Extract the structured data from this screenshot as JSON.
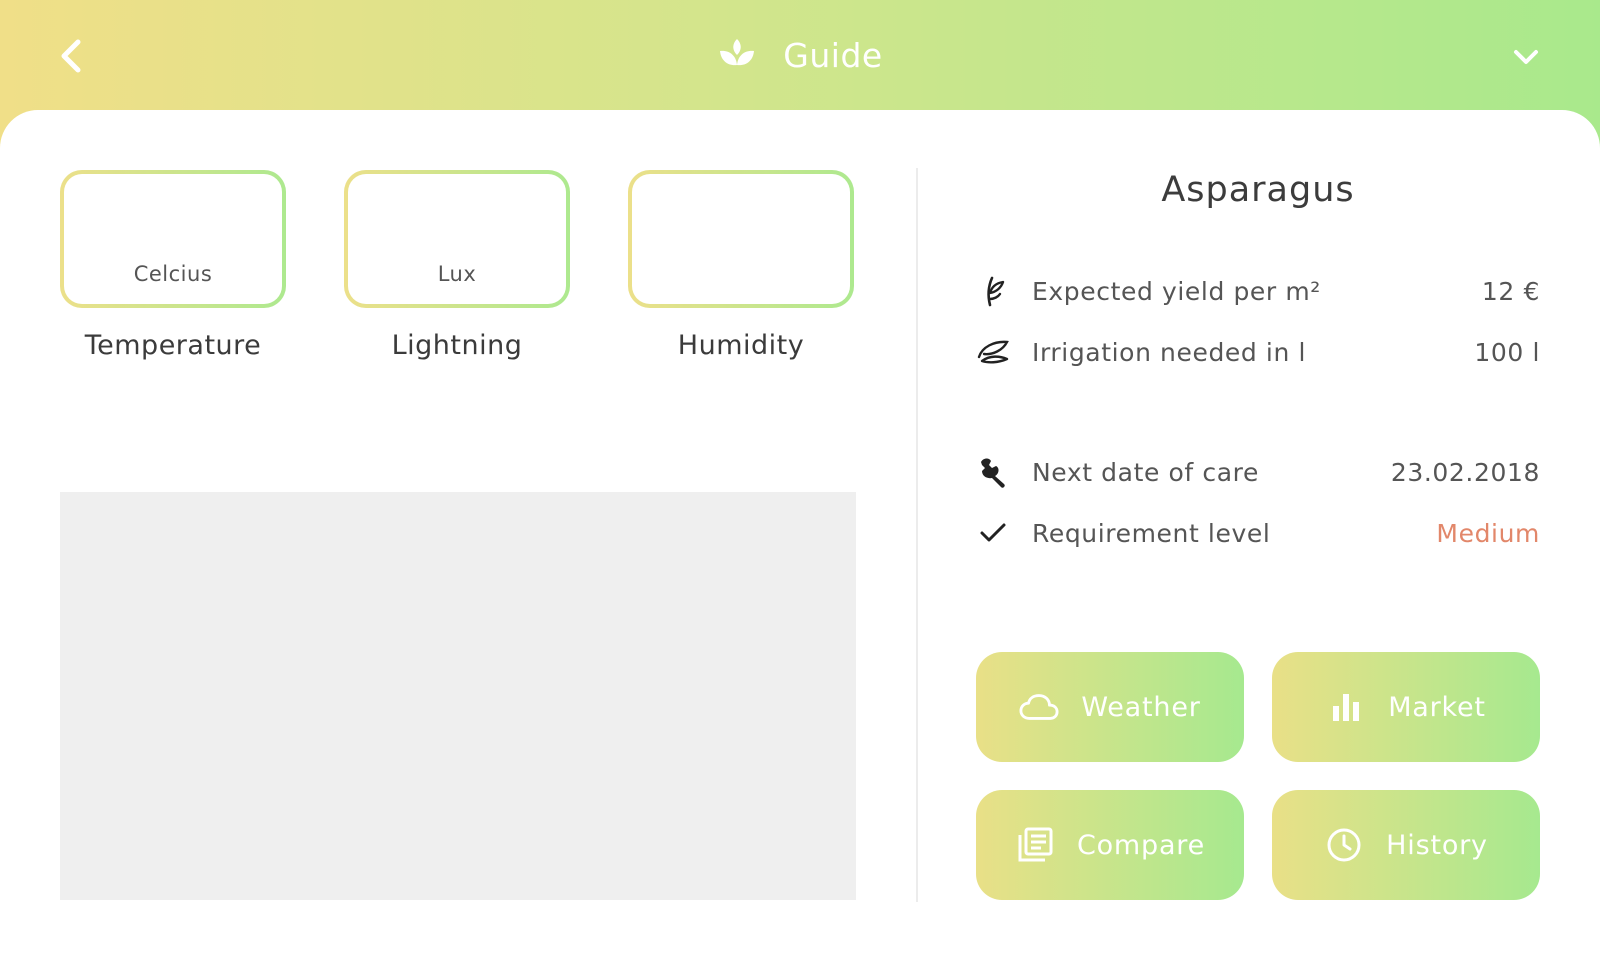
{
  "header": {
    "title": "Guide",
    "back_icon": "chevron-left-icon",
    "logo_icon": "plant-leaves-icon",
    "menu_icon": "chevron-down-icon"
  },
  "metrics": [
    {
      "unit": "Celcius",
      "label": "Temperature"
    },
    {
      "unit": "Lux",
      "label": "Lightning"
    },
    {
      "unit": "",
      "label": "Humidity"
    }
  ],
  "plant": {
    "name": "Asparagus",
    "info": [
      {
        "icon": "sprout-icon",
        "label": "Expected yield per m²",
        "value": "12 €"
      },
      {
        "icon": "water-drops-icon",
        "label": "Irrigation needed in l",
        "value": "100 l"
      },
      {
        "icon": "wrench-icon",
        "label": "Next date of care",
        "value": "23.02.2018"
      },
      {
        "icon": "checkmark-icon",
        "label": "Requirement level",
        "value": "Medium"
      }
    ]
  },
  "actions": [
    {
      "label": "Weather",
      "icon": "cloud-icon"
    },
    {
      "label": "Market",
      "icon": "bar-chart-icon"
    },
    {
      "label": "Compare",
      "icon": "documents-icon"
    },
    {
      "label": "History",
      "icon": "clock-icon"
    }
  ],
  "colors": {
    "gradient_start": "#f0df88",
    "gradient_end": "#a9e98c",
    "accent_medium": "#e2876a",
    "placeholder_gray": "#efefef"
  }
}
